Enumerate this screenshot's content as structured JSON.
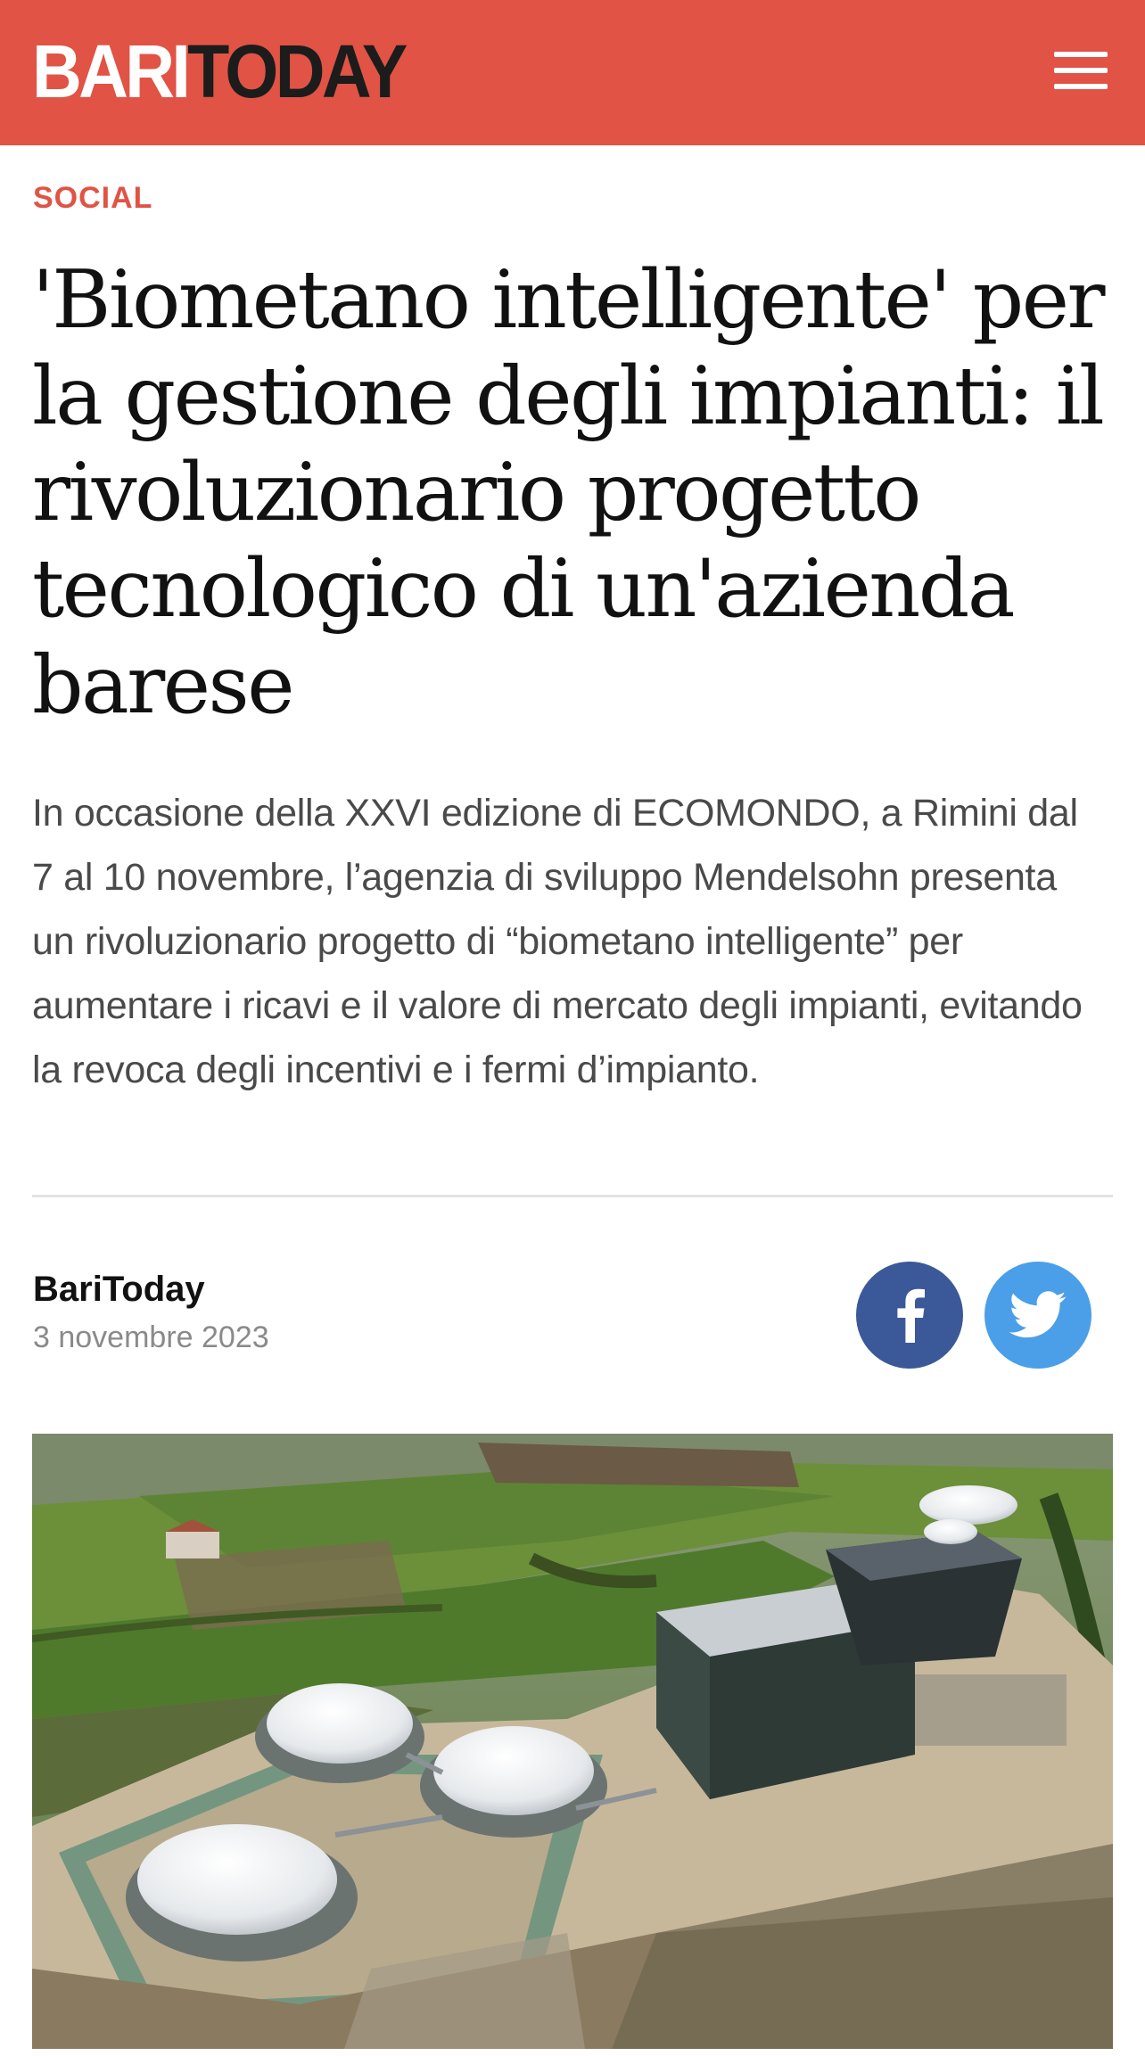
{
  "header": {
    "logo_part1": "BARI",
    "logo_part2": "TODAY",
    "brand_color": "#e05345",
    "menu_icon": "hamburger-menu-icon"
  },
  "article": {
    "section": "SOCIAL",
    "title": "'Biometano intelligente' per la gestione degli impianti: il rivoluzionario progetto tecnologico di un'azienda barese",
    "summary": "In occasione della XXVI edizione di ECOMONDO, a Rimini dal 7 al 10 novembre, l’agenzia di sviluppo Mendelsohn presenta un rivoluzionario progetto di “biometano intelligente” per aumentare i ricavi e il valore di mercato degli impianti, evitando la revoca degli incentivi e i fermi d’impianto.",
    "author": "BariToday",
    "date": "3 novembre 2023"
  },
  "share": {
    "facebook_icon": "facebook-icon",
    "facebook_color": "#3b5998",
    "twitter_icon": "twitter-icon",
    "twitter_color": "#4a9fe8"
  },
  "hero_image": {
    "description_icon": "biogas-plant-aerial-photo"
  }
}
